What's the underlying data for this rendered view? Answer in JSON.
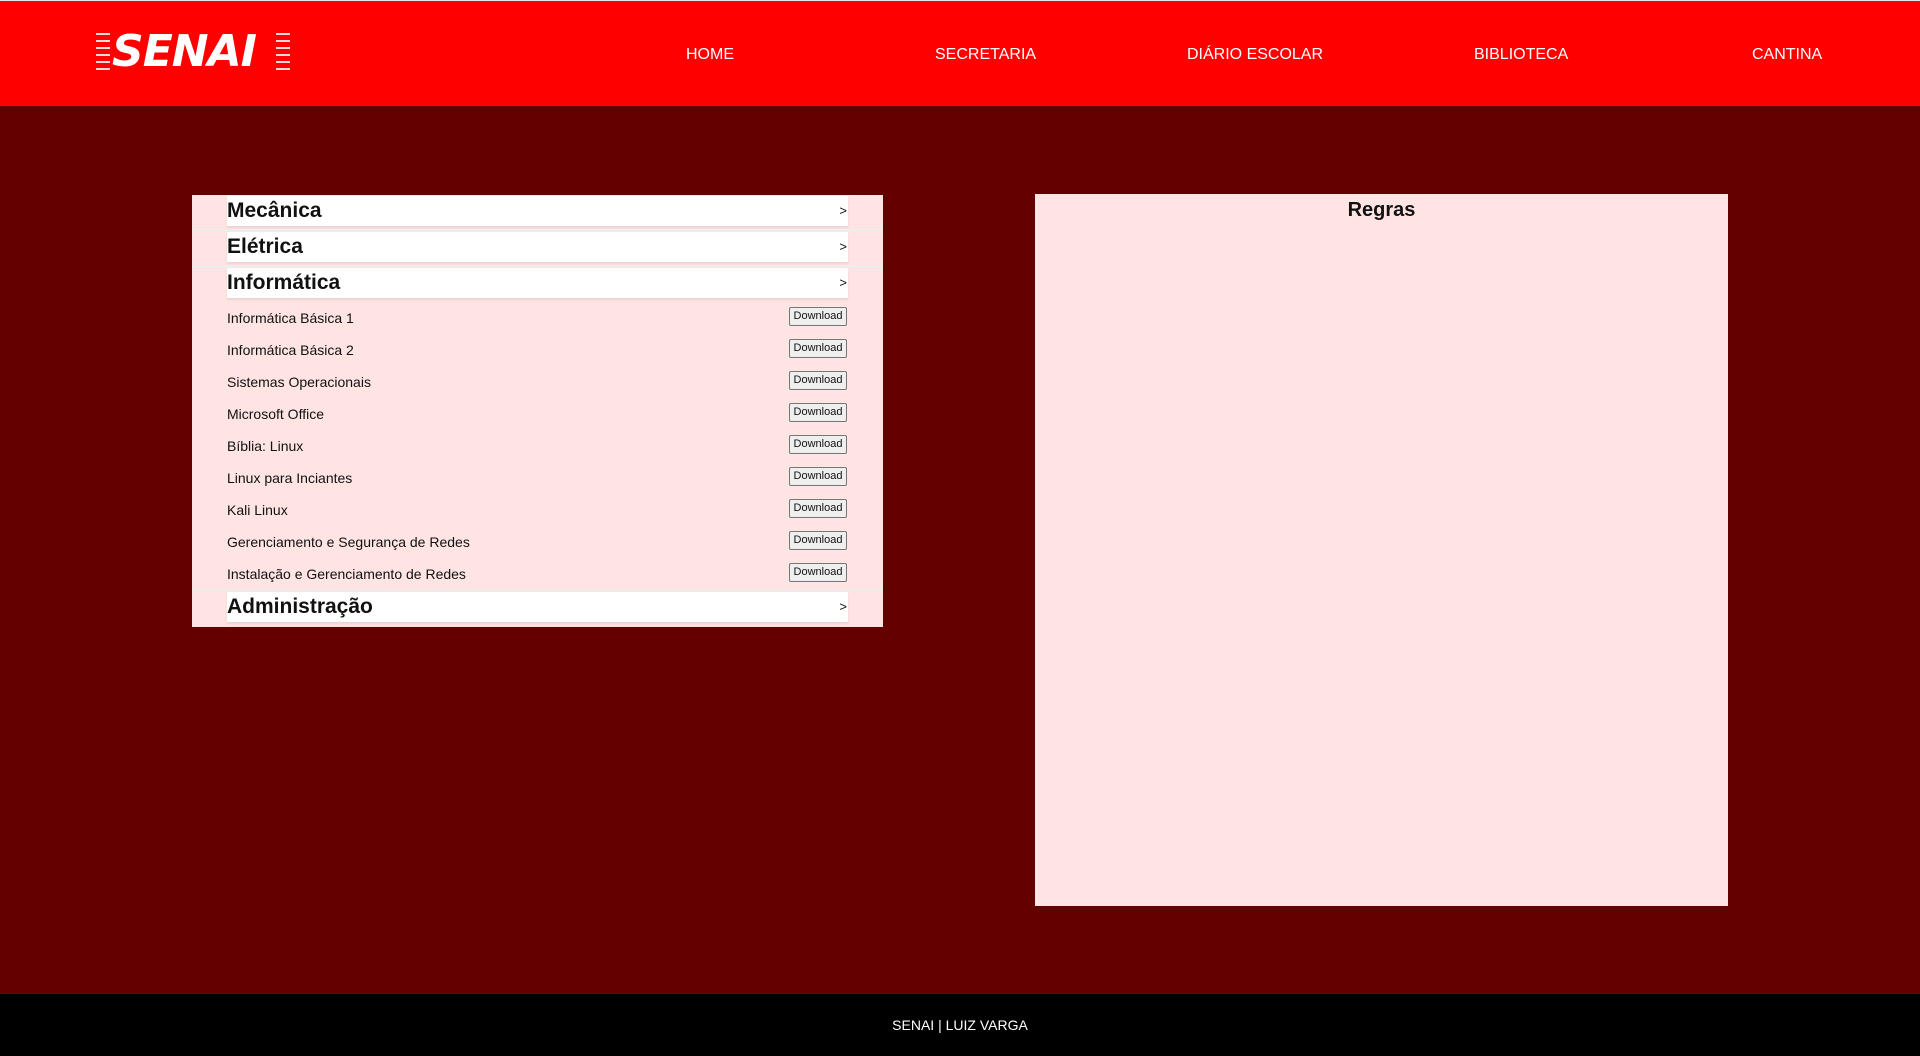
{
  "colors": {
    "header_bg": "#ff0000",
    "page_bg": "#630000",
    "panel_bg": "#ffe4e4",
    "footer_bg": "#000000"
  },
  "header": {
    "logo_text": "SENAI",
    "nav": [
      "HOME",
      "SECRETARIA",
      "DIÁRIO ESCOLAR",
      "BIBLIOTECA",
      "CANTINA"
    ]
  },
  "accordion": {
    "sections": [
      {
        "title": "Mecânica",
        "arrow": ">",
        "expanded": false
      },
      {
        "title": "Elétrica",
        "arrow": ">",
        "expanded": false
      },
      {
        "title": "Informática",
        "arrow": ">",
        "expanded": true
      },
      {
        "title": "Administração",
        "arrow": ">",
        "expanded": false
      }
    ],
    "files": [
      {
        "name": "Informática Básica 1",
        "button": "Download"
      },
      {
        "name": "Informática Básica 2",
        "button": "Download"
      },
      {
        "name": "Sistemas Operacionais",
        "button": "Download"
      },
      {
        "name": "Microsoft Office",
        "button": "Download"
      },
      {
        "name": "Bíblia: Linux",
        "button": "Download"
      },
      {
        "name": "Linux para Inciantes",
        "button": "Download"
      },
      {
        "name": "Kali Linux",
        "button": "Download"
      },
      {
        "name": "Gerenciamento e Segurança de Redes",
        "button": "Download"
      },
      {
        "name": "Instalação e Gerenciamento de Redes",
        "button": "Download"
      }
    ]
  },
  "rules": {
    "title": "Regras"
  },
  "footer": {
    "text": "SENAI | LUIZ VARGA"
  }
}
